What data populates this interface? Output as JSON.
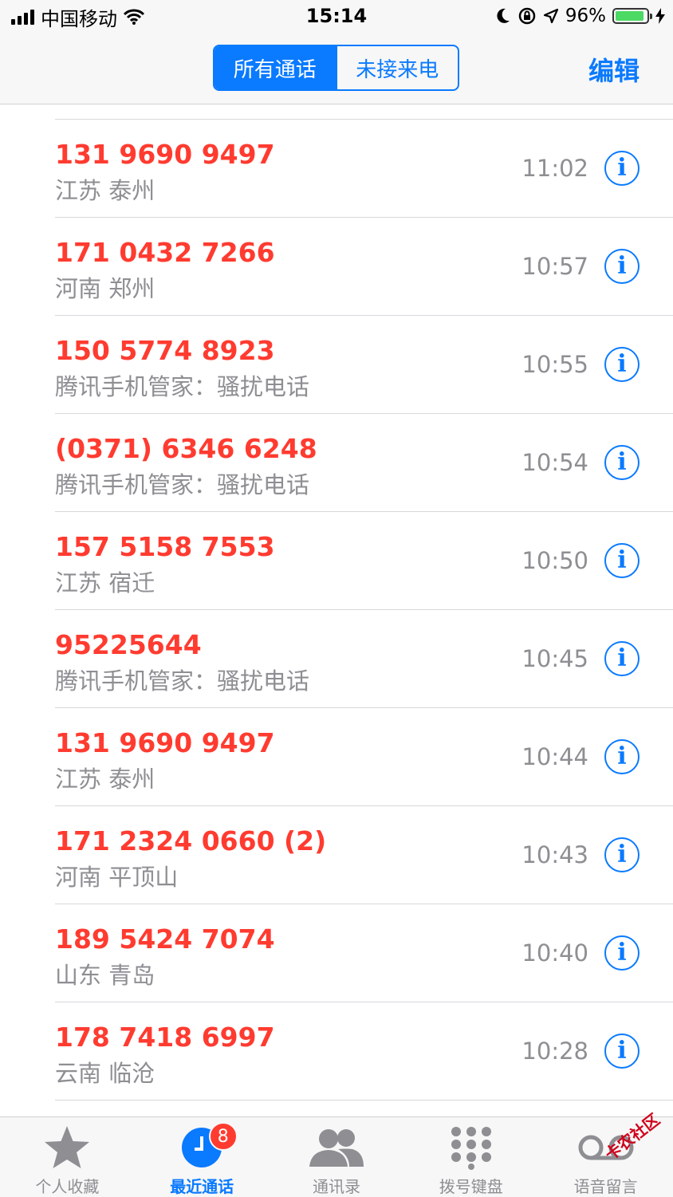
{
  "status": {
    "carrier": "中国移动",
    "time": "15:14",
    "battery": "96%"
  },
  "nav": {
    "segments": [
      "所有通话",
      "未接来电"
    ],
    "edit": "编辑"
  },
  "calls": [
    {
      "number": "131 9690 9497",
      "location": "江苏 泰州",
      "time": "11:02"
    },
    {
      "number": "171 0432 7266",
      "location": "河南 郑州",
      "time": "10:57"
    },
    {
      "number": "150 5774 8923",
      "location": "腾讯手机管家：骚扰电话",
      "time": "10:55"
    },
    {
      "number": "(0371) 6346 6248",
      "location": "腾讯手机管家：骚扰电话",
      "time": "10:54"
    },
    {
      "number": "157 5158 7553",
      "location": "江苏 宿迁",
      "time": "10:50"
    },
    {
      "number": "95225644",
      "location": "腾讯手机管家：骚扰电话",
      "time": "10:45"
    },
    {
      "number": "131 9690 9497",
      "location": "江苏 泰州",
      "time": "10:44"
    },
    {
      "number": "171 2324 0660 (2)",
      "location": "河南 平顶山",
      "time": "10:43"
    },
    {
      "number": "189 5424 7074",
      "location": "山东 青岛",
      "time": "10:40"
    },
    {
      "number": "178 7418 6997",
      "location": "云南 临沧",
      "time": "10:28"
    }
  ],
  "tabs": [
    {
      "label": "个人收藏",
      "icon": "star-icon"
    },
    {
      "label": "最近通话",
      "icon": "clock-icon",
      "badge": "8"
    },
    {
      "label": "通讯录",
      "icon": "contacts-icon"
    },
    {
      "label": "拨号键盘",
      "icon": "keypad-icon"
    },
    {
      "label": "语音留言",
      "icon": "voicemail-icon"
    }
  ],
  "watermark": "卡农社区",
  "colors": {
    "accent": "#0a7aff",
    "missed": "#ff3b30",
    "secondary": "#8e8e93"
  }
}
